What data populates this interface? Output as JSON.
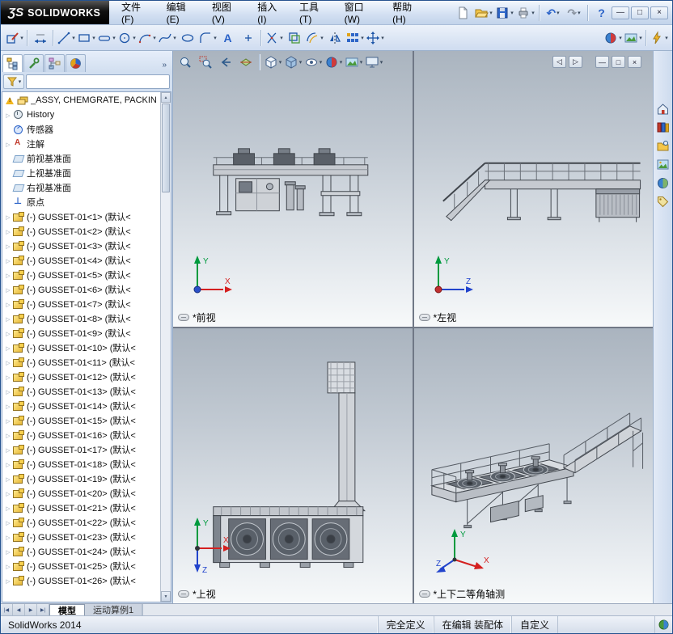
{
  "titlebar": {
    "logo_mark": "ƷS",
    "logo_text": "SOLIDWORKS",
    "menus": [
      {
        "label": "文件(F)"
      },
      {
        "label": "编辑(E)"
      },
      {
        "label": "视图(V)"
      },
      {
        "label": "插入(I)"
      },
      {
        "label": "工具(T)"
      },
      {
        "label": "窗口(W)"
      },
      {
        "label": "帮助(H)"
      }
    ],
    "window_buttons": {
      "minimize": "—",
      "maximize": "□",
      "close": "×"
    }
  },
  "panel": {
    "chevron": "»",
    "tree": {
      "root_label": "_ASSY, CHEMGRATE, PACKIN",
      "items": [
        {
          "type": "history",
          "label": "History"
        },
        {
          "type": "sensors",
          "label": "传感器"
        },
        {
          "type": "annotations",
          "label": "注解"
        },
        {
          "type": "plane",
          "label": "前视基准面"
        },
        {
          "type": "plane",
          "label": "上视基准面"
        },
        {
          "type": "plane",
          "label": "右视基准面"
        },
        {
          "type": "origin",
          "label": "原点"
        },
        {
          "type": "component",
          "label": "(-) GUSSET-01<1> (默认<"
        },
        {
          "type": "component",
          "label": "(-) GUSSET-01<2> (默认<"
        },
        {
          "type": "component",
          "label": "(-) GUSSET-01<3> (默认<"
        },
        {
          "type": "component",
          "label": "(-) GUSSET-01<4> (默认<"
        },
        {
          "type": "component",
          "label": "(-) GUSSET-01<5> (默认<"
        },
        {
          "type": "component",
          "label": "(-) GUSSET-01<6> (默认<"
        },
        {
          "type": "component",
          "label": "(-) GUSSET-01<7> (默认<"
        },
        {
          "type": "component",
          "label": "(-) GUSSET-01<8> (默认<"
        },
        {
          "type": "component",
          "label": "(-) GUSSET-01<9> (默认<"
        },
        {
          "type": "component",
          "label": "(-) GUSSET-01<10> (默认<"
        },
        {
          "type": "component",
          "label": "(-) GUSSET-01<11> (默认<"
        },
        {
          "type": "component",
          "label": "(-) GUSSET-01<12> (默认<"
        },
        {
          "type": "component",
          "label": "(-) GUSSET-01<13> (默认<"
        },
        {
          "type": "component",
          "label": "(-) GUSSET-01<14> (默认<"
        },
        {
          "type": "component",
          "label": "(-) GUSSET-01<15> (默认<"
        },
        {
          "type": "component",
          "label": "(-) GUSSET-01<16> (默认<"
        },
        {
          "type": "component",
          "label": "(-) GUSSET-01<17> (默认<"
        },
        {
          "type": "component",
          "label": "(-) GUSSET-01<18> (默认<"
        },
        {
          "type": "component",
          "label": "(-) GUSSET-01<19> (默认<"
        },
        {
          "type": "component",
          "label": "(-) GUSSET-01<20> (默认<"
        },
        {
          "type": "component",
          "label": "(-) GUSSET-01<21> (默认<"
        },
        {
          "type": "component",
          "label": "(-) GUSSET-01<22> (默认<"
        },
        {
          "type": "component",
          "label": "(-) GUSSET-01<23> (默认<"
        },
        {
          "type": "component",
          "label": "(-) GUSSET-01<24> (默认<"
        },
        {
          "type": "component",
          "label": "(-) GUSSET-01<25> (默认<"
        },
        {
          "type": "component",
          "label": "(-) GUSSET-01<26> (默认<"
        }
      ]
    }
  },
  "viewport": {
    "views": [
      {
        "label": "*前视",
        "triad": {
          "v": "Y",
          "h": "X"
        }
      },
      {
        "label": "*左视",
        "triad": {
          "v": "Y",
          "h": "Z"
        }
      },
      {
        "label": "*上视",
        "triad": {
          "v": "Y",
          "h": "X",
          "d": "Z"
        }
      },
      {
        "label": "*上下二等角轴测",
        "triad": {
          "v": "Y",
          "h": "X",
          "d": "Z"
        }
      }
    ],
    "doc_buttons": {
      "prev": "◁",
      "next": "▷",
      "minimize": "—",
      "restore": "□",
      "close": "×"
    }
  },
  "tabbar": {
    "nav": [
      {
        "g": "|◀"
      },
      {
        "g": "◀"
      },
      {
        "g": "▶"
      },
      {
        "g": "▶|"
      }
    ],
    "tabs": [
      {
        "label": "模型",
        "cls": "active"
      },
      {
        "label": "运动算例1",
        "cls": "inactive"
      }
    ]
  },
  "statusbar": {
    "app": "SolidWorks 2014",
    "define_state": "完全定义",
    "edit_state": "在编辑 装配体",
    "custom": "自定义"
  }
}
